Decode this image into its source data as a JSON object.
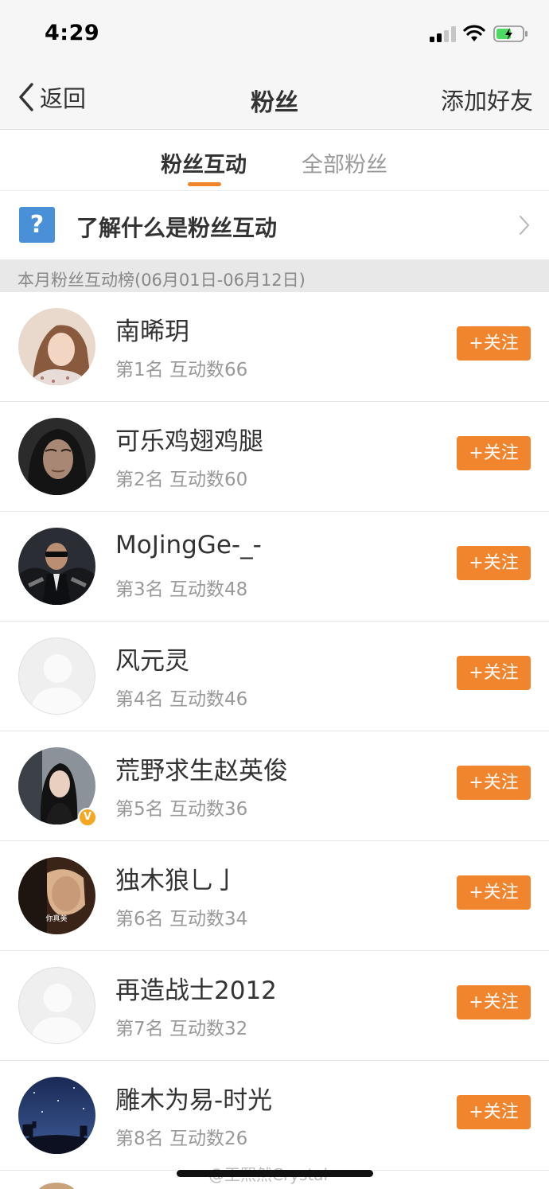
{
  "status_bar": {
    "time": "4:29"
  },
  "nav": {
    "back_label": "返回",
    "title": "粉丝",
    "right_action": "添加好友"
  },
  "tabs": [
    {
      "label": "粉丝互动",
      "active": true
    },
    {
      "label": "全部粉丝",
      "active": false
    }
  ],
  "info_row": {
    "text": "了解什么是粉丝互动",
    "icon_char": "?"
  },
  "section_header": "本月粉丝互动榜(06月01日-06月12日)",
  "fans": [
    {
      "name": "南晞玥",
      "meta": "第1名 互动数66",
      "follow": "+关注",
      "avatar": "photo-woman",
      "verified": false
    },
    {
      "name": "可乐鸡翅鸡腿",
      "meta": "第2名 互动数60",
      "follow": "+关注",
      "avatar": "photo-dark-woman",
      "verified": false
    },
    {
      "name": "MoJingGe-_-",
      "meta": "第3名 互动数48",
      "follow": "+关注",
      "avatar": "photo-man-suit",
      "verified": false
    },
    {
      "name": "风元灵",
      "meta": "第4名 互动数46",
      "follow": "+关注",
      "avatar": "placeholder",
      "verified": false
    },
    {
      "name": "荒野求生赵英俊",
      "meta": "第5名 互动数36",
      "follow": "+关注",
      "avatar": "photo-woman-car",
      "verified": true,
      "verified_mark": "V"
    },
    {
      "name": "独木狼乚亅",
      "meta": "第6名 互动数34",
      "follow": "+关注",
      "avatar": "photo-man-movie",
      "verified": false,
      "avatar_caption": "你真美"
    },
    {
      "name": "再造战士2012",
      "meta": "第7名 互动数32",
      "follow": "+关注",
      "avatar": "placeholder",
      "verified": false
    },
    {
      "name": "雕木为易-时光",
      "meta": "第8名 互动数26",
      "follow": "+关注",
      "avatar": "photo-night-sky",
      "verified": false
    }
  ],
  "watermark": "@王熙然Crystal",
  "colors": {
    "accent": "#f1852e",
    "question_icon": "#4a90d9",
    "verified": "#f5a623"
  }
}
